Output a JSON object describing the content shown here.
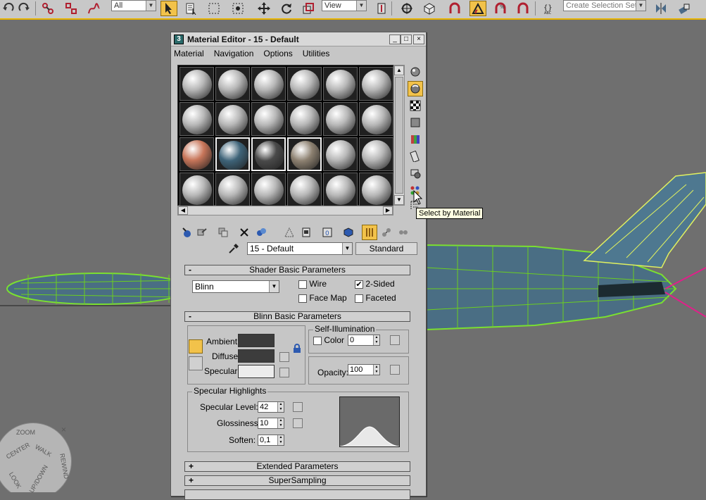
{
  "toolbar": {
    "filter_value": "All",
    "ref_coord_value": "View",
    "selection_set_placeholder": "Create Selection Set"
  },
  "material_editor": {
    "title": "Material Editor - 15 - Default",
    "menu": [
      "Material",
      "Navigation",
      "Options",
      "Utilities"
    ],
    "material_name": "15 - Default",
    "material_type": "Standard",
    "tooltip": "Select by Material",
    "shader_rollout": {
      "title": "Shader Basic Parameters",
      "collapse": "-",
      "shader": "Blinn",
      "wire_label": "Wire",
      "two_sided_label": "2-Sided",
      "face_map_label": "Face Map",
      "faceted_label": "Faceted",
      "two_sided_checked": "✔"
    },
    "blinn_rollout": {
      "title": "Blinn Basic Parameters",
      "collapse": "-",
      "ambient_label": "Ambient:",
      "diffuse_label": "Diffuse:",
      "specular_label": "Specular:",
      "ambient_color": "#3c3c3c",
      "diffuse_color": "#3c3c3c",
      "specular_color": "#ececec",
      "self_illum_title": "Self-Illumination",
      "color_label": "Color",
      "self_illum_value": "0",
      "opacity_label": "Opacity:",
      "opacity_value": "100",
      "spec_highlights_title": "Specular Highlights",
      "spec_level_label": "Specular Level:",
      "spec_level_value": "42",
      "glossiness_label": "Glossiness:",
      "glossiness_value": "10",
      "soften_label": "Soften:",
      "soften_value": "0,1"
    },
    "extended_rollout": {
      "title": "Extended Parameters",
      "expand": "+"
    },
    "supersampling_rollout": {
      "title": "SuperSampling",
      "expand": "+"
    },
    "sample_slot_colors": {
      "default": "#b8b8b8",
      "orange": "#c8765a",
      "blue": "#3e6378",
      "black": "#4a4a4a",
      "glass": "#8c8070"
    }
  },
  "nav_wheel": {
    "zoom": "ZOOM",
    "center": "CENTER",
    "walk": "WALK",
    "rewind": "REWIND",
    "look": "LOOK",
    "updown": "UP/DOWN",
    "close": "×"
  }
}
